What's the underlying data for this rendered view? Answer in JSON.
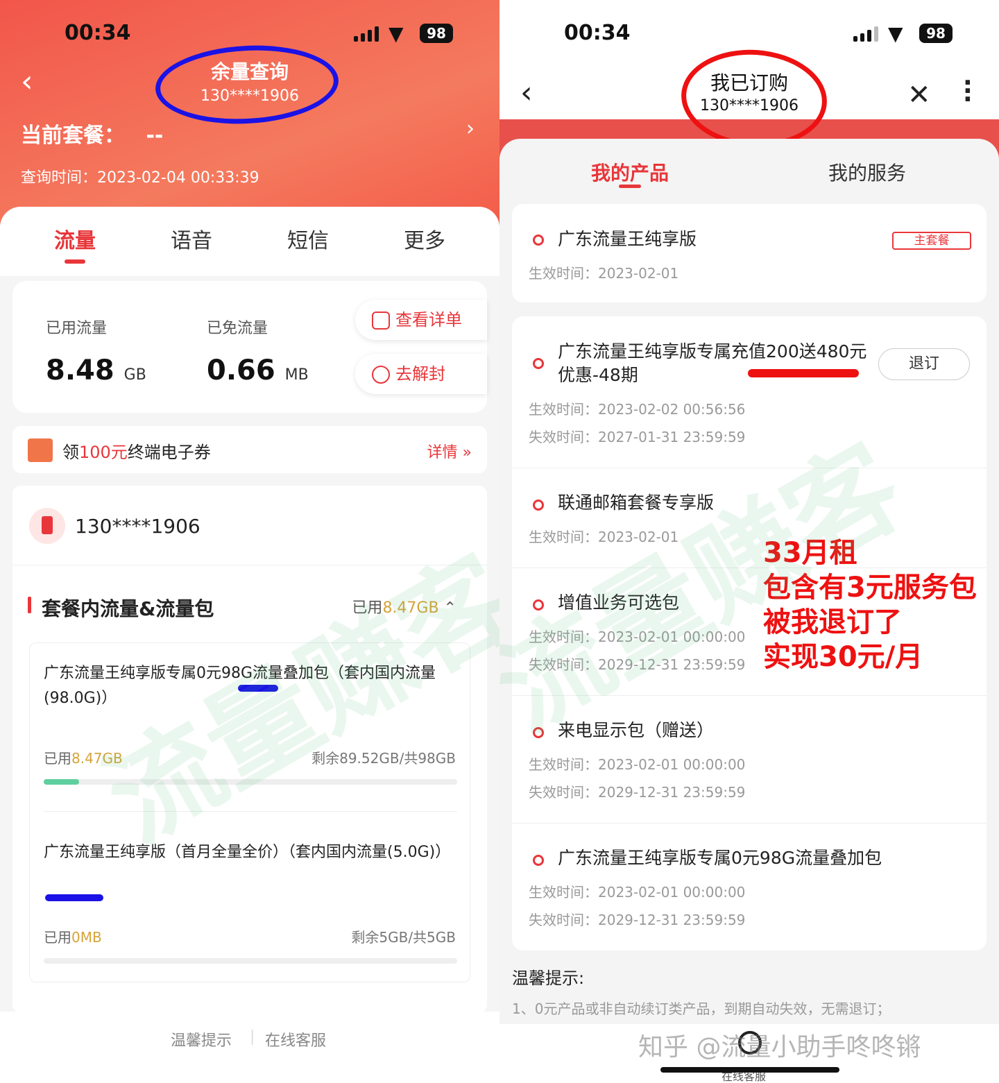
{
  "left": {
    "status": {
      "time": "00:34",
      "battery": "98"
    },
    "header": {
      "title": "余量查询",
      "phone": "130****1906",
      "plan_label": "当前套餐：",
      "plan_value": "--",
      "query_time": "查询时间：2023-02-04 00:33:39"
    },
    "tabs": [
      "流量",
      "语音",
      "短信",
      "更多"
    ],
    "usage": {
      "used_label": "已用流量",
      "used_value": "8.48",
      "used_unit": "GB",
      "free_label": "已免流量",
      "free_value": "0.66",
      "free_unit": "MB",
      "detail_btn": "查看详单",
      "unblock_btn": "去解封"
    },
    "coupon": {
      "prefix": "领",
      "amount": "100元",
      "suffix": "终端电子券",
      "more": "详情 »"
    },
    "plan_box": {
      "phone": "130****1906",
      "section_title": "套餐内流量&流量包",
      "section_used_prefix": "已用",
      "section_used_value": "8.47GB",
      "packages": [
        {
          "name": "广东流量王纯享版专属0元98G流量叠加包（套内国内流量(98.0G)）",
          "used_prefix": "已用",
          "used": "8.47GB",
          "remain": "剩余89.52GB/共98GB",
          "fraction": 0.0864
        },
        {
          "name": "广东流量王纯享版（首月全量全价）（套内国内流量(5.0G)）",
          "used_prefix": "已用",
          "used": "0MB",
          "remain": "剩余5GB/共5GB",
          "fraction": 0
        }
      ]
    },
    "footer": {
      "tips": "温馨提示",
      "service": "在线客服"
    },
    "watermark": "流量赚客"
  },
  "right": {
    "status": {
      "time": "00:34",
      "battery": "98"
    },
    "header": {
      "title": "我已订购",
      "phone": "130****1906"
    },
    "tabs": [
      "我的产品",
      "我的服务"
    ],
    "products": [
      {
        "name": "广东流量王纯享版",
        "badge": "主套餐",
        "start": "生效时间：2023-02-01"
      },
      {
        "name": "广东流量王纯享版专属充值200送480元优惠-48期",
        "action": "退订",
        "start": "生效时间：2023-02-02 00:56:56",
        "end": "失效时间：2027-01-31 23:59:59"
      },
      {
        "name": "联通邮箱套餐专享版",
        "start": "生效时间：2023-02-01"
      },
      {
        "name": "增值业务可选包",
        "start": "生效时间：2023-02-01 00:00:00",
        "end": "失效时间：2029-12-31 23:59:59"
      },
      {
        "name": "来电显示包（赠送）",
        "start": "生效时间：2023-02-01 00:00:00",
        "end": "失效时间：2029-12-31 23:59:59"
      },
      {
        "name": "广东流量王纯享版专属0元98G流量叠加包",
        "start": "生效时间：2023-02-01 00:00:00",
        "end": "失效时间：2029-12-31 23:59:59"
      }
    ],
    "annotation": [
      "33月租",
      "包含有3元服务包",
      "被我退订了",
      "实现30元/月"
    ],
    "tips_title": "温馨提示:",
    "tips_1": "1、0元产品或非自动续订类产品，到期自动失效，无需退订；",
    "footer_service": "在线客服",
    "watermark_text": "知乎 @流量小助手咚咚锵",
    "watermark": "流量赚客"
  }
}
